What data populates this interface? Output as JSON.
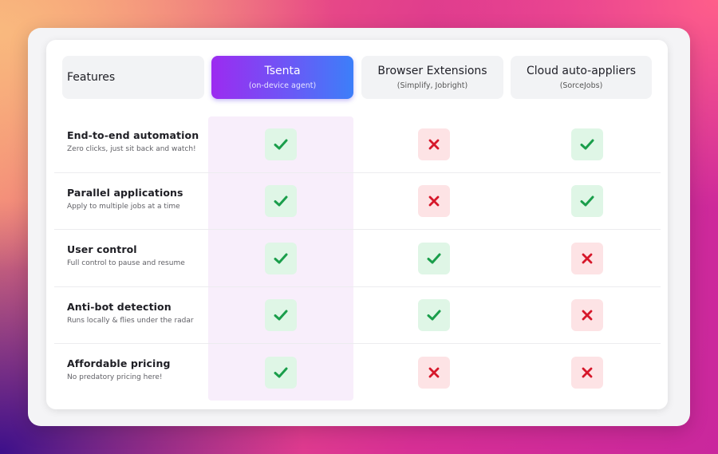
{
  "header": {
    "features_label": "Features",
    "columns": [
      {
        "title": "Tsenta",
        "subtitle": "(on-device agent)"
      },
      {
        "title": "Browser Extensions",
        "subtitle": "(Simplify, Jobright)"
      },
      {
        "title": "Cloud auto-appliers",
        "subtitle": "(SorceJobs)"
      }
    ]
  },
  "rows": [
    {
      "title": "End-to-end automation",
      "subtitle": "Zero clicks, just sit back and watch!",
      "values": [
        "check",
        "cross",
        "check"
      ]
    },
    {
      "title": "Parallel applications",
      "subtitle": "Apply to multiple jobs at a time",
      "values": [
        "check",
        "cross",
        "check"
      ]
    },
    {
      "title": "User control",
      "subtitle": "Full control to pause and resume",
      "values": [
        "check",
        "check",
        "cross"
      ]
    },
    {
      "title": "Anti-bot detection",
      "subtitle": "Runs locally & flies under the radar",
      "values": [
        "check",
        "check",
        "cross"
      ]
    },
    {
      "title": "Affordable pricing",
      "subtitle": "No predatory pricing here!",
      "values": [
        "check",
        "cross",
        "cross"
      ]
    }
  ],
  "colors": {
    "check": "#1a9e4b",
    "cross": "#d6182b",
    "accent_start": "#9c2bf0",
    "accent_end": "#3c7ff9"
  }
}
